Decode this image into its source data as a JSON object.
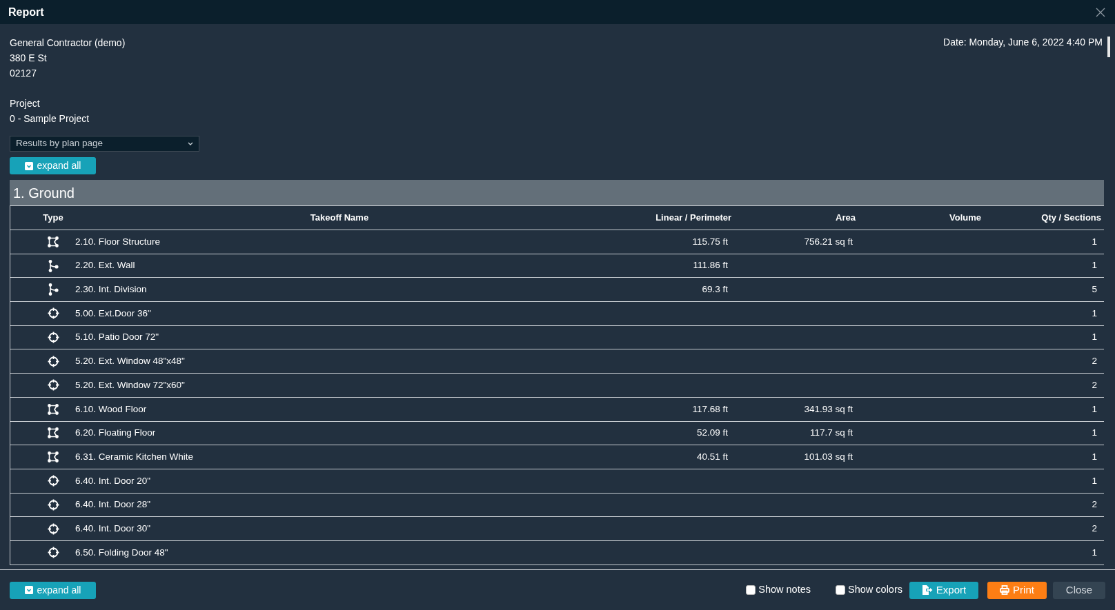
{
  "window": {
    "title": "Report"
  },
  "company": {
    "name": "General Contractor (demo)",
    "street": "380 E St",
    "zip": "02127"
  },
  "date": "Date: Monday, June 6, 2022 4:40 PM",
  "project": {
    "label": "Project",
    "name": "0 - Sample Project"
  },
  "view_select": {
    "value": "Results by plan page"
  },
  "expand_top": "expand all",
  "group": {
    "title": "1. Ground"
  },
  "table": {
    "columns": [
      "Type",
      "Takeoff Name",
      "Linear / Perimeter",
      "Area",
      "Volume",
      "Qty / Sections"
    ],
    "rows": [
      {
        "kind": "area",
        "name": "2.10. Floor Structure",
        "linear": "115.75 ft",
        "area": "756.21 sq ft",
        "qty": "1"
      },
      {
        "kind": "line",
        "name": "2.20. Ext. Wall",
        "linear": "111.86 ft",
        "area": "",
        "qty": "1"
      },
      {
        "kind": "line",
        "name": "2.30. Int. Division",
        "linear": "69.3 ft",
        "area": "",
        "qty": "5"
      },
      {
        "kind": "count",
        "name": "5.00. Ext.Door 36\"",
        "linear": "",
        "area": "",
        "qty": "1"
      },
      {
        "kind": "count",
        "name": "5.10. Patio Door 72\"",
        "linear": "",
        "area": "",
        "qty": "1"
      },
      {
        "kind": "count",
        "name": "5.20. Ext. Window 48\"x48\"",
        "linear": "",
        "area": "",
        "qty": "2"
      },
      {
        "kind": "count",
        "name": "5.20. Ext. Window 72\"x60\"",
        "linear": "",
        "area": "",
        "qty": "2"
      },
      {
        "kind": "area",
        "name": "6.10. Wood Floor",
        "linear": "117.68 ft",
        "area": "341.93 sq ft",
        "qty": "1"
      },
      {
        "kind": "area",
        "name": "6.20. Floating Floor",
        "linear": "52.09 ft",
        "area": "117.7 sq ft",
        "qty": "1"
      },
      {
        "kind": "area",
        "name": "6.31. Ceramic Kitchen White",
        "linear": "40.51 ft",
        "area": "101.03 sq ft",
        "qty": "1"
      },
      {
        "kind": "count",
        "name": "6.40. Int. Door 20\"",
        "linear": "",
        "area": "",
        "qty": "1"
      },
      {
        "kind": "count",
        "name": "6.40. Int. Door 28\"",
        "linear": "",
        "area": "",
        "qty": "2"
      },
      {
        "kind": "count",
        "name": "6.40. Int. Door 30\"",
        "linear": "",
        "area": "",
        "qty": "2"
      },
      {
        "kind": "count",
        "name": "6.50. Folding Door 48\"",
        "linear": "",
        "area": "",
        "qty": "1"
      }
    ]
  },
  "footer": {
    "expand": "expand all",
    "checkboxes": [
      {
        "label": "Show notes",
        "checked": false
      },
      {
        "label": "Show colors",
        "checked": false
      }
    ],
    "buttons": [
      {
        "kind": "export",
        "label": "Export"
      },
      {
        "kind": "print",
        "label": "Print"
      },
      {
        "kind": "close",
        "label": "Close"
      }
    ]
  }
}
